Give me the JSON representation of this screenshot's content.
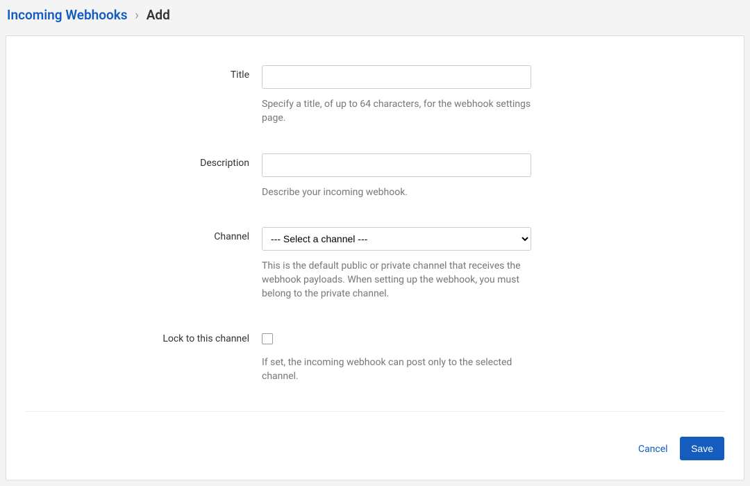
{
  "breadcrumb": {
    "parent": "Incoming Webhooks",
    "current": "Add"
  },
  "fields": {
    "title": {
      "label": "Title",
      "value": "",
      "help": "Specify a title, of up to 64 characters, for the webhook settings page."
    },
    "description": {
      "label": "Description",
      "value": "",
      "help": "Describe your incoming webhook."
    },
    "channel": {
      "label": "Channel",
      "placeholder": "--- Select a channel ---",
      "help": "This is the default public or private channel that receives the webhook payloads. When setting up the webhook, you must belong to the private channel."
    },
    "lock": {
      "label": "Lock to this channel",
      "help": "If set, the incoming webhook can post only to the selected channel."
    }
  },
  "footer": {
    "cancel": "Cancel",
    "save": "Save"
  }
}
